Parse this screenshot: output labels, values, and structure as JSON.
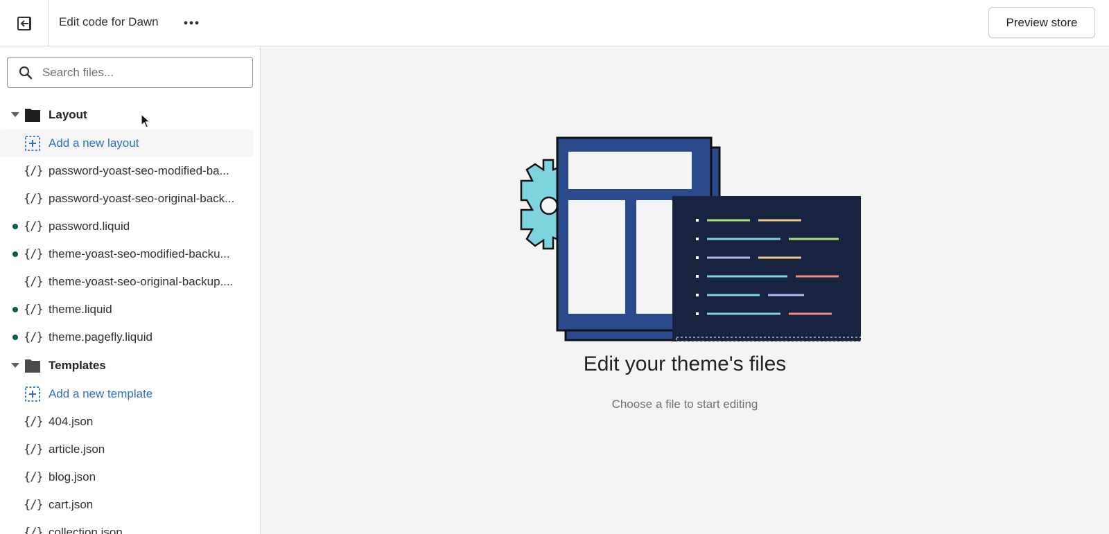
{
  "header": {
    "title": "Edit code for Dawn",
    "preview_label": "Preview store"
  },
  "search": {
    "placeholder": "Search files..."
  },
  "layout_folder": {
    "name": "Layout",
    "add_label": "Add a new layout",
    "files": [
      {
        "name": "password-yoast-seo-modified-ba...",
        "modified": false
      },
      {
        "name": "password-yoast-seo-original-back...",
        "modified": false
      },
      {
        "name": "password.liquid",
        "modified": true
      },
      {
        "name": "theme-yoast-seo-modified-backu...",
        "modified": true
      },
      {
        "name": "theme-yoast-seo-original-backup....",
        "modified": false
      },
      {
        "name": "theme.liquid",
        "modified": true
      },
      {
        "name": "theme.pagefly.liquid",
        "modified": true
      }
    ]
  },
  "templates_folder": {
    "name": "Templates",
    "add_label": "Add a new template",
    "files": [
      {
        "name": "404.json"
      },
      {
        "name": "article.json"
      },
      {
        "name": "blog.json"
      },
      {
        "name": "cart.json"
      },
      {
        "name": "collection.json"
      }
    ]
  },
  "empty_state": {
    "title": "Edit your theme's files",
    "subtitle": "Choose a file to start editing"
  },
  "icons": {
    "file_icon_glyph": "{/}",
    "exit": "exit-icon",
    "more": "more-horizontal-icon",
    "search": "search-icon",
    "folder": "folder-icon",
    "add": "add-file-icon"
  },
  "colors": {
    "modified_dot": "#0b5f3c",
    "link": "#2c6ecb"
  }
}
